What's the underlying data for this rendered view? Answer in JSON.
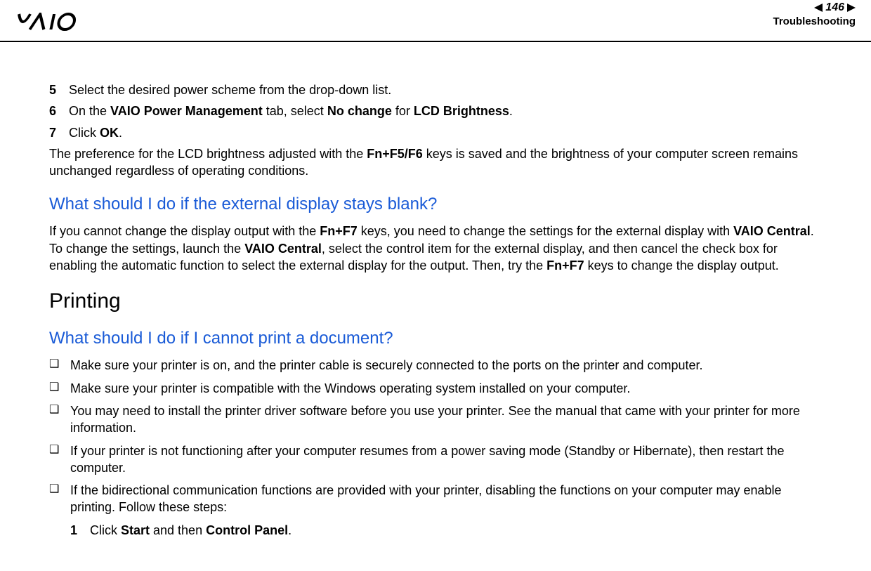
{
  "header": {
    "logo_text": "VAIO",
    "page_number": "146",
    "section": "Troubleshooting"
  },
  "steps": {
    "s5": {
      "num": "5",
      "text": "Select the desired power scheme from the drop-down list."
    },
    "s6": {
      "num": "6",
      "pre": "On the ",
      "b1": "VAIO Power Management",
      "mid1": " tab, select ",
      "b2": "No change",
      "mid2": " for ",
      "b3": "LCD Brightness",
      "post": "."
    },
    "s7": {
      "num": "7",
      "pre": "Click ",
      "b1": "OK",
      "post": "."
    }
  },
  "para1": {
    "pre": "The preference for the LCD brightness adjusted with the ",
    "b1": "Fn+F5/F6",
    "post": " keys is saved and the brightness of your computer screen remains unchanged regardless of operating conditions."
  },
  "heading1": "What should I do if the external display stays blank?",
  "para2": {
    "t1": "If you cannot change the display output with the ",
    "b1": "Fn+F7",
    "t2": " keys, you need to change the settings for the external display with ",
    "b2": "VAIO Central",
    "t3": ". To change the settings, launch the ",
    "b3": "VAIO Central",
    "t4": ", select the control item for the external display, and then cancel the check box for enabling the automatic function to select the external display for the output. Then, try the ",
    "b4": "Fn+F7",
    "t5": " keys to change the display output."
  },
  "heading2": "Printing",
  "heading3": "What should I do if I cannot print a document?",
  "bullets": {
    "b1": "Make sure your printer is on, and the printer cable is securely connected to the ports on the printer and computer.",
    "b2": "Make sure your printer is compatible with the Windows operating system installed on your computer.",
    "b3": "You may need to install the printer driver software before you use your printer. See the manual that came with your printer for more information.",
    "b4": "If your printer is not functioning after your computer resumes from a power saving mode (Standby or Hibernate), then restart the computer.",
    "b5": "If the bidirectional communication functions are provided with your printer, disabling the functions on your computer may enable printing. Follow these steps:"
  },
  "substep1": {
    "num": "1",
    "pre": "Click ",
    "b1": "Start",
    "mid": " and then ",
    "b2": "Control Panel",
    "post": "."
  }
}
